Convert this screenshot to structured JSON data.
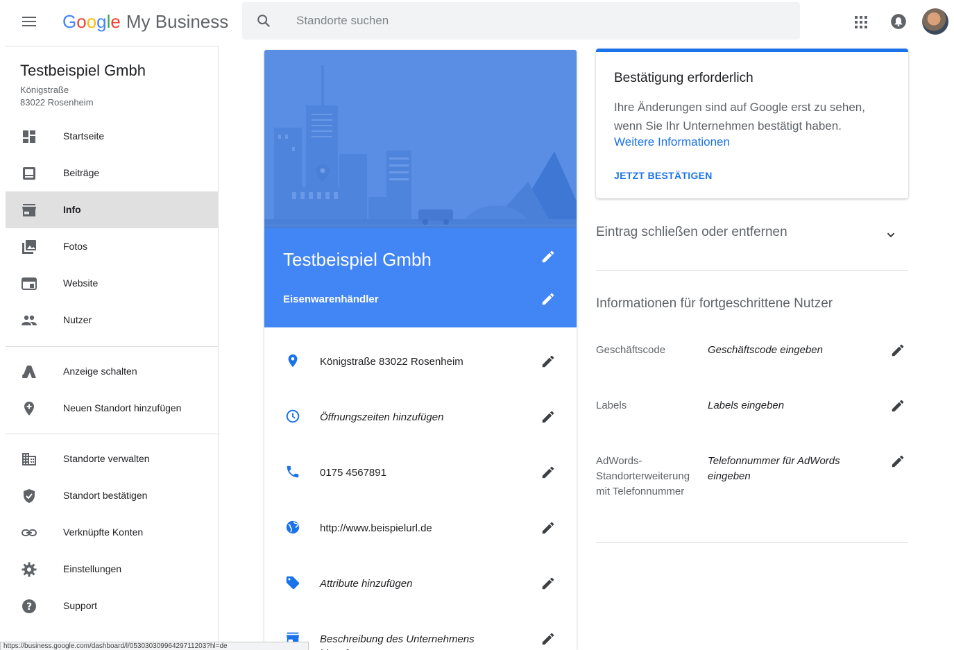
{
  "header": {
    "logo_google": [
      "G",
      "o",
      "o",
      "g",
      "l",
      "e"
    ],
    "logo_product": "My Business",
    "search_placeholder": "Standorte suchen"
  },
  "sidebar": {
    "business_name": "Testbeispiel Gmbh",
    "address_line1": "Königstraße",
    "address_line2": "83022 Rosenheim",
    "items": [
      {
        "label": "Startseite",
        "icon": "dashboard-icon"
      },
      {
        "label": "Beiträge",
        "icon": "posts-icon"
      },
      {
        "label": "Info",
        "icon": "storefront-icon",
        "active": true
      },
      {
        "label": "Fotos",
        "icon": "photos-icon"
      },
      {
        "label": "Website",
        "icon": "website-icon"
      },
      {
        "label": "Nutzer",
        "icon": "users-icon"
      },
      {
        "label": "Anzeige schalten",
        "icon": "adwords-icon"
      },
      {
        "label": "Neuen Standort hinzufügen",
        "icon": "add-location-icon"
      },
      {
        "label": "Standorte verwalten",
        "icon": "building-icon"
      },
      {
        "label": "Standort bestätigen",
        "icon": "shield-check-icon"
      },
      {
        "label": "Verknüpfte Konten",
        "icon": "link-icon"
      },
      {
        "label": "Einstellungen",
        "icon": "gear-icon"
      },
      {
        "label": "Support",
        "icon": "help-icon"
      }
    ]
  },
  "main": {
    "business_name": "Testbeispiel Gmbh",
    "category": "Eisenwarenhändler",
    "rows": [
      {
        "text": "Königstraße 83022 Rosenheim",
        "icon": "location-pin-icon",
        "placeholder": false
      },
      {
        "text": "Öffnungszeiten hinzufügen",
        "icon": "clock-icon",
        "placeholder": true
      },
      {
        "text": "0175 4567891",
        "icon": "phone-icon",
        "placeholder": false
      },
      {
        "text": "http://www.beispielurl.de",
        "icon": "globe-icon",
        "placeholder": false
      },
      {
        "text": "Attribute hinzufügen",
        "icon": "tag-icon",
        "placeholder": true
      },
      {
        "text": "Beschreibung des Unternehmens hinzufügen",
        "icon": "storefront-icon",
        "placeholder": true
      }
    ]
  },
  "verify": {
    "title": "Bestätigung erforderlich",
    "body": "Ihre Änderungen sind auf Google erst zu sehen, wenn Sie Ihr Unternehmen bestätigt haben.",
    "link": "Weitere Informationen",
    "button": "JETZT BESTÄTIGEN"
  },
  "close_section": {
    "title": "Eintrag schließen oder entfernen"
  },
  "advanced": {
    "title": "Informationen für fortgeschrittene Nutzer",
    "rows": [
      {
        "label": "Geschäftscode",
        "value": "Geschäftscode eingeben"
      },
      {
        "label": "Labels",
        "value": "Labels eingeben"
      },
      {
        "label": "AdWords-Standorterweiterung mit Telefonnummer",
        "value": "Telefonnummer für AdWords eingeben"
      }
    ]
  },
  "status_url": "https://business.google.com/dashboard/l/05303030996429711203?hl=de",
  "colors": {
    "accent": "#4285f4",
    "link": "#1a73e8",
    "active_nav": "#e0e0e0"
  }
}
